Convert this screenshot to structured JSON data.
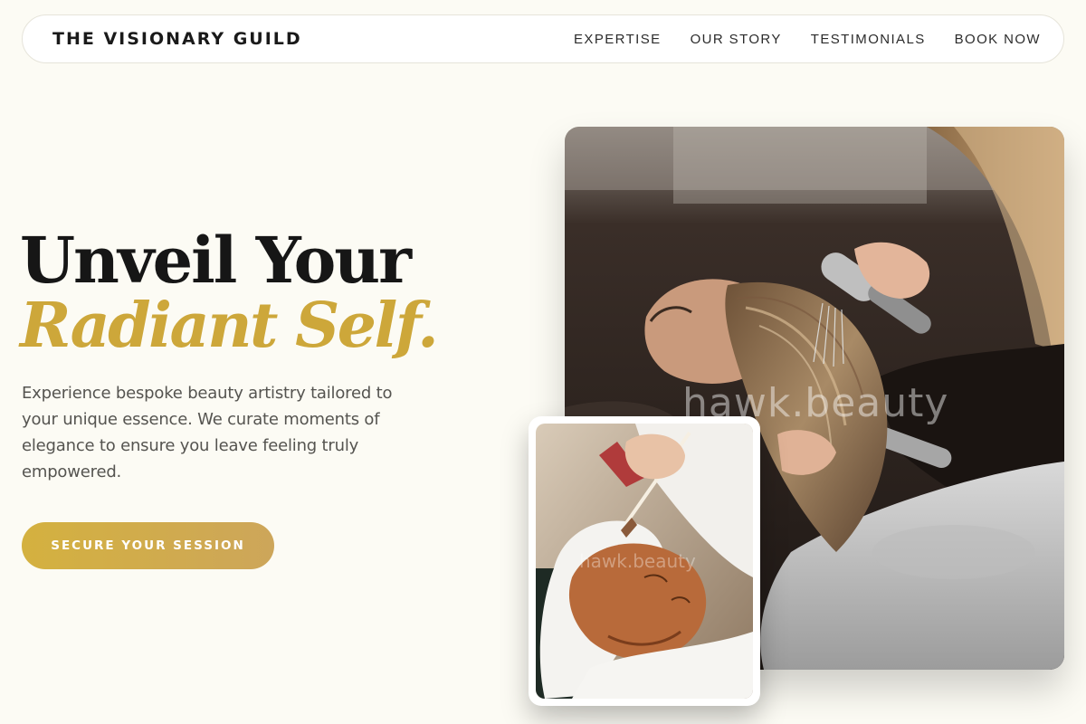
{
  "nav": {
    "brand": "THE VISIONARY GUILD",
    "links": [
      "EXPERTISE",
      "OUR STORY",
      "TESTIMONIALS",
      "BOOK NOW"
    ]
  },
  "hero": {
    "title_line1": "Unveil Your",
    "title_line2": "Radiant Self.",
    "description": "Experience bespoke beauty artistry tailored to your unique essence. We curate moments of elegance to ensure you leave feeling truly empowered.",
    "cta_label": "SECURE YOUR SESSION"
  },
  "images": {
    "main_watermark": "hawk.beauty",
    "inset_watermark": "hawk.beauty"
  },
  "colors": {
    "background": "#fcfbf4",
    "accent_gold": "#cda73a",
    "text_dark": "#161616"
  }
}
